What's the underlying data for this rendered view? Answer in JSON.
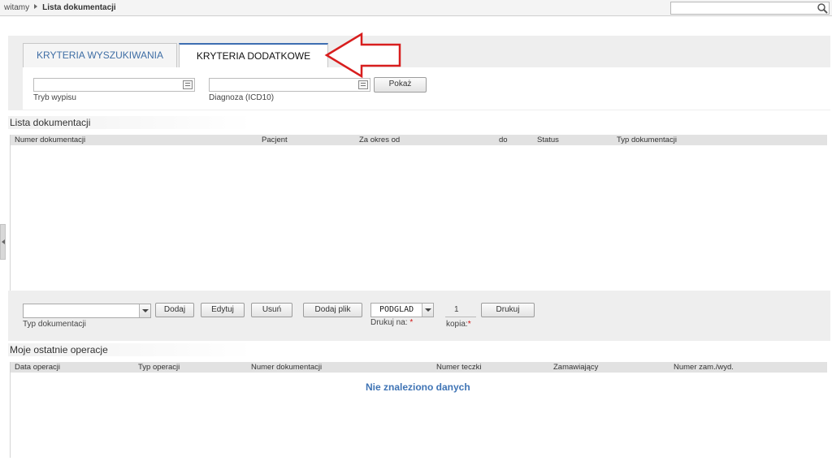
{
  "breadcrumb": {
    "home": "witamy",
    "current": "Lista dokumentacji"
  },
  "search": {
    "value": ""
  },
  "tabs": [
    {
      "label": "KRYTERIA WYSZUKIWANIA",
      "active": false
    },
    {
      "label": "KRYTERIA DODATKOWE",
      "active": true
    }
  ],
  "criteria": {
    "tryb_wypisu": {
      "label": "Tryb wypisu",
      "value": ""
    },
    "diagnoza": {
      "label": "Diagnoza (ICD10)",
      "value": ""
    },
    "show_button": "Pokaż"
  },
  "documentation_list": {
    "title": "Lista dokumentacji",
    "columns": [
      "Numer dokumentacji",
      "Pacjent",
      "Za okres od",
      "do",
      "Status",
      "Typ dokumentacji"
    ],
    "rows": []
  },
  "actions": {
    "type_label": "Typ dokumentacji",
    "type_value": "",
    "add": "Dodaj",
    "edit": "Edytuj",
    "delete": "Usuń",
    "add_file": "Dodaj plik",
    "print_target": "PODGLAD",
    "print_on_label": "Drukuj na:",
    "copies": "1",
    "copies_label": "kopia:",
    "required_mark": "*",
    "print": "Drukuj"
  },
  "recent_operations": {
    "title": "Moje ostatnie operacje",
    "columns": [
      "Data operacji",
      "Typ operacji",
      "Numer dokumentacji",
      "Numer teczki",
      "Zamawiający",
      "Numer zam./wyd."
    ],
    "empty_message": "Nie znaleziono danych"
  },
  "colors": {
    "accent": "#3d6eb1",
    "annotation": "#d81e1e",
    "empty_text": "#3f74b5"
  },
  "icons": [
    "search-icon",
    "picker-icon",
    "dropdown-arrow-icon",
    "collapse-panel-icon",
    "annotation-arrow-icon"
  ]
}
